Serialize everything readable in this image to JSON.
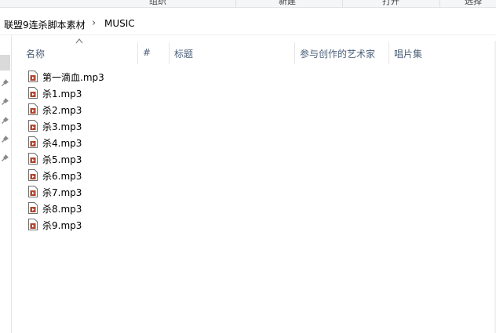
{
  "ribbon": {
    "labels": [
      "组织",
      "新建",
      "打开",
      "选择"
    ]
  },
  "address": {
    "crumbs": [
      "联盟9连杀脚本素材",
      "MUSIC"
    ],
    "separator": "›"
  },
  "columns": {
    "name": "名称",
    "number": "#",
    "title": "标题",
    "artist": "参与创作的艺术家",
    "album": "唱片集"
  },
  "files": [
    "第一滴血.mp3",
    "杀1.mp3",
    "杀2.mp3",
    "杀3.mp3",
    "杀4.mp3",
    "杀5.mp3",
    "杀6.mp3",
    "杀7.mp3",
    "杀8.mp3",
    "杀9.mp3"
  ],
  "icons": {
    "file": "audio-file-icon",
    "pin": "pin-icon",
    "sort": "sort-ascending-icon"
  },
  "colors": {
    "header_text": "#4c607a",
    "audio_badge": "#b2462e"
  }
}
